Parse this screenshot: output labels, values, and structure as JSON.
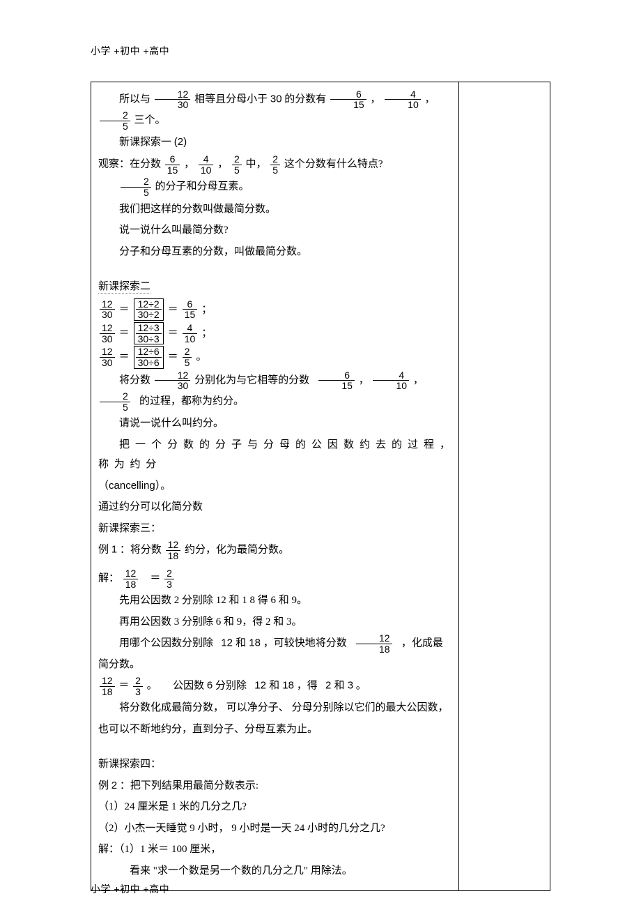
{
  "header": "小学 +初中 +高中",
  "footer": "小学 +初中 +高中",
  "p1_a": "所以与",
  "f12_30_n": "12",
  "f12_30_d": "30",
  "p1_b": "相等且分母小于",
  "p1_c": "30",
  "p1_d": "的分数有",
  "f6_15_n": "6",
  "f6_15_d": "15",
  "f4_10_n": "4",
  "f4_10_d": "10",
  "f2_5_n": "2",
  "f2_5_d": "5",
  "p1_e": "三个。",
  "comma": "，",
  "p2": "新课探索一",
  "p2_num": "(2)",
  "p3_a": "观察：在分数",
  "p3_b": "中，",
  "p3_c": "这个分数有什么特点?",
  "p4": "的分子和分母互素。",
  "p5": "我们把这样的分数叫做最简分数。",
  "p6": "说一说什么叫最简分数?",
  "p7": "分子和分母互素的分数，叫做最简分数。",
  "p8": "新课探索二",
  "eq1_l_n": "12",
  "eq1_l_d": "30",
  "eq1_m_n": "12÷2",
  "eq1_m_d": "30÷2",
  "eq1_r_n": "6",
  "eq1_r_d": "15",
  "eq2_m_n": "12÷3",
  "eq2_m_d": "30÷3",
  "eq2_r_n": "4",
  "eq2_r_d": "10",
  "eq3_m_n": "12÷6",
  "eq3_m_d": "30÷6",
  "eq3_r_n": "2",
  "eq3_r_d": "5",
  "eq_eq": "＝",
  "semi": "；",
  "period_cn": "。",
  "p9_a": "将分数",
  "p9_b": "分别化为与它相等的分数",
  "p9_c": "的过程，都称为约分。",
  "p10": "请说一说什么叫约分。",
  "p11_a": "把 一 个 分 数 的 分 子 与 分 母 的 公 因 数 约 去 的 过 程 ， 称 为 约 分",
  "p11_b": "（",
  "p11_c": "cancelling",
  "p11_d": "）。",
  "p12": "通过约分可以化简分数",
  "p13": "新课探索三：",
  "p14_a": "例",
  "p14_b": "1",
  "p14_c": "：将分数",
  "f12_18_n": "12",
  "f12_18_d": "18",
  "p14_d": "约分，化为最简分数。",
  "p15_a": "解：",
  "p15_eq": "＝",
  "f2_3_n": "2",
  "f2_3_d": "3",
  "p16": "先用公因数  2 分别除  12 和 1 8  得 6 和 9。",
  "p17": "再用公因数  3 分别除  6 和 9，得  2 和 3。",
  "p18_a": "用哪个公因数分别除",
  "p18_b": "12 和 18",
  "p18_c": "，可较快地将分数",
  "p18_d": "，化成最简分数。",
  "p19_a": "公因数",
  "p19_b": "6",
  "p19_c": "分别除",
  "p19_d": "12 和 18",
  "p19_e": "，得",
  "p19_f": "2 和 3",
  "p20": "将分数化成最简分数，  可以净分子、 分母分别除以它们的最大公因数，",
  "p21": "也可以不断地约分，直到分子、分母互素为止。",
  "p22": "新课探索四：",
  "p23_a": "例",
  "p23_b": "2",
  "p23_c": "：把下列结果用最简分数表示:",
  "p24": "（1）24 厘米是  1 米的几分之几?",
  "p25": "（2）小杰一天睡觉  9 小时， 9 小时是一天  24 小时的几分之几?",
  "p26": "解：（1）1 米＝ 100 厘米，",
  "p27": "看来 \"求一个数是另一个数的几分之几\" 用除法。"
}
